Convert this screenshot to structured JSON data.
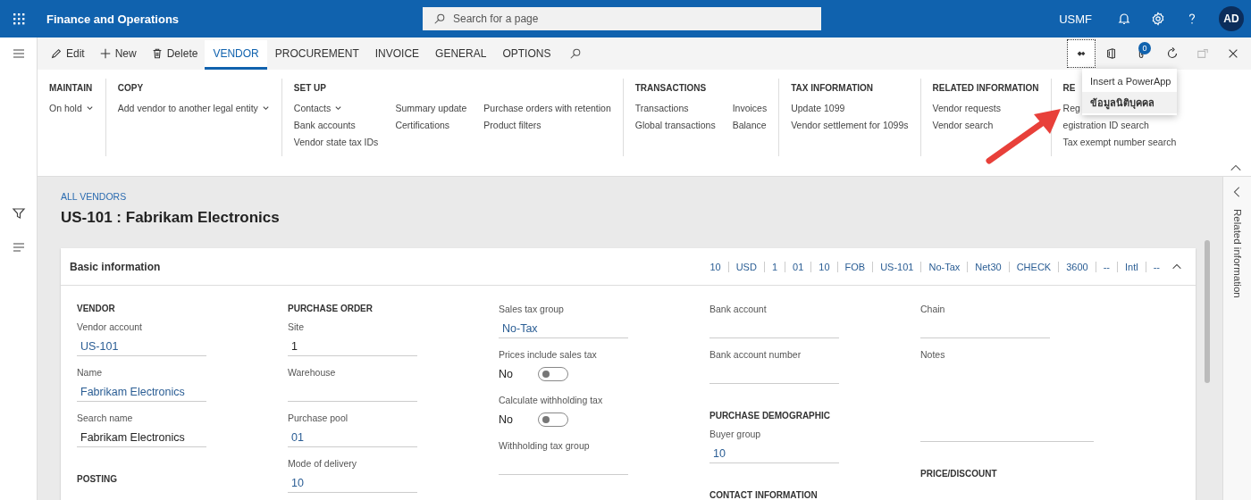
{
  "top_bar": {
    "title": "Finance and Operations",
    "search": {
      "placeholder": "Search for a page"
    },
    "company": "USMF",
    "avatar": "AD"
  },
  "action_pane": {
    "actions": [
      {
        "kind": "edit",
        "label": "Edit"
      },
      {
        "kind": "new",
        "label": "New"
      },
      {
        "kind": "delete",
        "label": "Delete"
      }
    ],
    "tabs": [
      {
        "label": "VENDOR",
        "selected": true
      },
      {
        "label": "PROCUREMENT",
        "selected": false
      },
      {
        "label": "INVOICE",
        "selected": false
      },
      {
        "label": "GENERAL",
        "selected": false
      },
      {
        "label": "OPTIONS",
        "selected": false
      }
    ],
    "tools": [
      {
        "kind": "powerapps",
        "active": true,
        "disabled": false
      },
      {
        "kind": "office",
        "active": false,
        "disabled": false
      },
      {
        "kind": "attach",
        "active": false,
        "disabled": false,
        "badge": "0"
      },
      {
        "kind": "refresh",
        "active": false,
        "disabled": false
      },
      {
        "kind": "popout",
        "active": false,
        "disabled": true
      },
      {
        "kind": "close",
        "active": false,
        "disabled": false
      }
    ]
  },
  "ribbon": {
    "groups": [
      {
        "title": "MAINTAIN",
        "columns": [
          [
            {
              "label": "On hold",
              "dropdown": true
            }
          ]
        ]
      },
      {
        "title": "COPY",
        "columns": [
          [
            {
              "label": "Add vendor to another legal entity",
              "dropdown": true
            }
          ]
        ]
      },
      {
        "title": "SET UP",
        "columns": [
          [
            {
              "label": "Contacts",
              "dropdown": true
            },
            {
              "label": "Bank accounts",
              "dropdown": false
            },
            {
              "label": "Vendor state tax IDs",
              "dropdown": false
            }
          ],
          [
            {
              "label": "Summary update",
              "dropdown": false
            },
            {
              "label": "Certifications",
              "dropdown": false
            }
          ],
          [
            {
              "label": "Purchase orders with retention",
              "dropdown": false
            },
            {
              "label": "Product filters",
              "dropdown": false
            }
          ]
        ]
      },
      {
        "title": "TRANSACTIONS",
        "columns": [
          [
            {
              "label": "Transactions",
              "dropdown": false
            },
            {
              "label": "Global transactions",
              "dropdown": false
            }
          ],
          [
            {
              "label": "Invoices",
              "dropdown": false
            },
            {
              "label": "Balance",
              "dropdown": false
            }
          ]
        ]
      },
      {
        "title": "TAX INFORMATION",
        "columns": [
          [
            {
              "label": "Update 1099",
              "dropdown": false
            },
            {
              "label": "Vendor settlement for 1099s",
              "dropdown": false
            }
          ]
        ]
      },
      {
        "title": "RELATED INFORMATION",
        "columns": [
          [
            {
              "label": "Vendor requests",
              "dropdown": false
            },
            {
              "label": "Vendor search",
              "dropdown": false
            }
          ]
        ]
      },
      {
        "title": "RE",
        "columns": [
          [
            {
              "label": "Reg",
              "dropdown": false
            },
            {
              "label": "egistration ID search",
              "dropdown": false
            },
            {
              "label": "Tax exempt number search",
              "dropdown": false
            }
          ]
        ]
      }
    ]
  },
  "menu": {
    "items": [
      {
        "label": "Insert a PowerApp",
        "selected": false
      },
      {
        "label": "ข้อมูลนิติบุคคล",
        "selected": true
      }
    ]
  },
  "breadcrumb": "ALL VENDORS",
  "page_title": "US-101 : Fabrikam Electronics",
  "side_panel": {
    "label": "Related information"
  },
  "card": {
    "title": "Basic information",
    "summary": [
      "10",
      "USD",
      "1",
      "01",
      "10",
      "FOB",
      "US-101",
      "No-Tax",
      "Net30",
      "CHECK",
      "3600",
      "--",
      "Intl",
      "--"
    ],
    "columns": [
      [
        {
          "kind": "section",
          "label": "VENDOR"
        },
        {
          "kind": "lookup",
          "label": "Vendor account",
          "value": "US-101"
        },
        {
          "kind": "lookup",
          "label": "Name",
          "value": "Fabrikam Electronics"
        },
        {
          "kind": "text",
          "label": "Search name",
          "value": "Fabrikam Electronics"
        },
        {
          "kind": "section",
          "label": "POSTING"
        }
      ],
      [
        {
          "kind": "section",
          "label": "PURCHASE ORDER"
        },
        {
          "kind": "text",
          "label": "Site",
          "value": "1"
        },
        {
          "kind": "lookup",
          "label": "Warehouse"
        },
        {
          "kind": "lookup",
          "label": "Purchase pool",
          "value": "01"
        },
        {
          "kind": "lookup",
          "label": "Mode of delivery",
          "value": "10"
        }
      ],
      [
        {
          "kind": "lookup",
          "label": "Sales tax group",
          "value": "No-Tax"
        },
        {
          "kind": "toggle",
          "label": "Prices include sales tax",
          "value": "No",
          "on": false
        },
        {
          "kind": "toggle",
          "label": "Calculate withholding tax",
          "value": "No",
          "on": false
        },
        {
          "kind": "lookup",
          "label": "Withholding tax group"
        }
      ],
      [
        {
          "kind": "lookup",
          "label": "Bank account"
        },
        {
          "kind": "text",
          "label": "Bank account number"
        },
        {
          "kind": "section",
          "label": "PURCHASE DEMOGRAPHIC"
        },
        {
          "kind": "lookup",
          "label": "Buyer group",
          "value": "10"
        },
        {
          "kind": "section",
          "label": "CONTACT INFORMATION"
        }
      ],
      [
        {
          "kind": "lookup",
          "label": "Chain"
        },
        {
          "kind": "notes",
          "label": "Notes"
        },
        {
          "kind": "section",
          "label": "PRICE/DISCOUNT"
        }
      ]
    ]
  }
}
